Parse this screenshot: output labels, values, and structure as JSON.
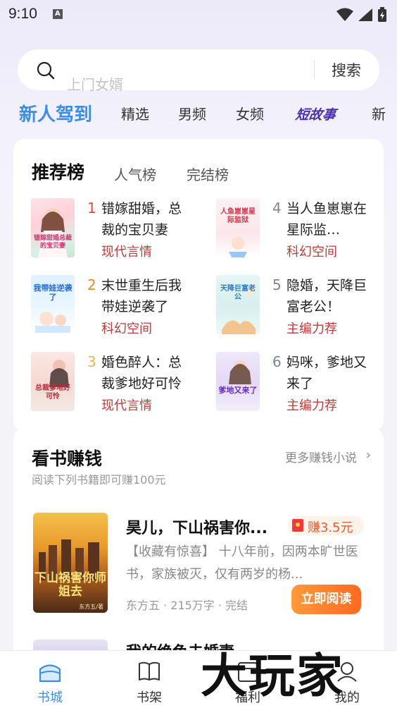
{
  "status_bar": {
    "time": "9:10",
    "notification_letter": "A"
  },
  "search": {
    "placeholder": "上门女婿",
    "button_label": "搜索"
  },
  "channel_tabs": [
    "新人驾到",
    "精选",
    "男频",
    "女频",
    "短故事",
    "新"
  ],
  "ranking": {
    "tabs": [
      "推荐榜",
      "人气榜",
      "完结榜"
    ],
    "items": [
      {
        "rank": "1",
        "title": "错嫁甜婚，总裁的宝贝妻",
        "genre": "现代言情",
        "cover_text": "错嫁甜婚总裁的宝贝妻"
      },
      {
        "rank": "2",
        "title": "末世重生后我带娃逆袭了",
        "genre": "科幻空间",
        "cover_text": "我带娃逆袭了"
      },
      {
        "rank": "3",
        "title": "婚色醉人：总裁爹地好可怜",
        "genre": "现代言情",
        "cover_text": "总裁爹地好可怜"
      },
      {
        "rank": "4",
        "title": "当人鱼崽崽在星际监…",
        "genre": "科幻空间",
        "cover_text": "人鱼崽崽星际监狱"
      },
      {
        "rank": "5",
        "title": "隐婚，天降巨富老公！",
        "genre": "主编力荐",
        "cover_text": "天降巨富老公"
      },
      {
        "rank": "6",
        "title": "妈咪，爹地又来了",
        "genre": "主编力荐",
        "cover_text": "爹地又来了"
      }
    ],
    "colors": {
      "rank1": "#e34b3b",
      "rank2": "#f08a24",
      "rank3": "#f0b34a",
      "rank_other": "#7a869a",
      "genre": "#c23a3a"
    }
  },
  "earn": {
    "title": "看书赚钱",
    "more_label": "更多赚钱小说",
    "subtitle": "阅读下列书籍即可赚100元",
    "book": {
      "title": "昊儿，下山祸害你...",
      "reward": "赚3.5元",
      "description": "【收藏有惊喜】 十八年前，因两本旷世医书，家族被灭，仅有两岁的杨...",
      "meta": "东方五 · 215万字 · 完结",
      "read_button": "立即阅读",
      "cover_text": "下山祸害你师姐去",
      "cover_author": "东方五/著"
    },
    "next_peek_title": "我的绝色未婚妻"
  },
  "bottom_nav": [
    "书城",
    "书架",
    "福利",
    "我的"
  ],
  "watermark": "大玩家",
  "accent_color": "#3a8ee6"
}
